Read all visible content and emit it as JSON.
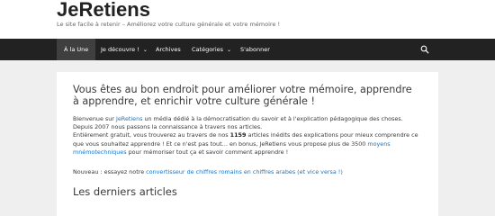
{
  "header": {
    "site_title": "JeRetiens",
    "tagline": "Le site facile à retenir – Améliorez votre culture générale et votre mémoire !"
  },
  "nav": {
    "items": [
      {
        "label": "À la Une"
      },
      {
        "label": "Je découvre !",
        "has_dropdown": true
      },
      {
        "label": "Archives"
      },
      {
        "label": "Catégories",
        "has_dropdown": true
      },
      {
        "label": "S'abonner"
      }
    ],
    "search_icon": "search-icon"
  },
  "main": {
    "hero": "Vous êtes au bon endroit pour améliorer votre mémoire, apprendre à apprendre, et enrichir votre culture générale !",
    "intro": {
      "p1_before": "Bienvenue sur ",
      "p1_link": "JeRetiens",
      "p1_after": " un média dédié à la démocratisation du savoir et à l'explication pédagogique des choses.",
      "p2": "Depuis 2007 nous passons la connaissance à travers nos articles.",
      "p3_before": "Entièrement gratuit, vous trouverez au travers de nos ",
      "p3_count": "1159",
      "p3_middle": " articles inédits des explications pour mieux comprendre ce que vous souhaitez apprendre ! Et ce n'est pas tout… en bonus, JeRetiens vous propose plus de 3500 ",
      "p3_link": "moyens mnémotechniques",
      "p3_after": " pour mémoriser tout ça et savoir comment apprendre !"
    },
    "nouveau_before": "Nouveau : essayez notre ",
    "nouveau_link": "convertisseur de chiffres romains en chiffres arabes (et vice versa !)",
    "section_title": "Les derniers articles"
  },
  "colors": {
    "nav_bg": "#222222",
    "nav_active": "#3f3f3f",
    "link": "#1e73be",
    "page_bg": "#efefef"
  }
}
